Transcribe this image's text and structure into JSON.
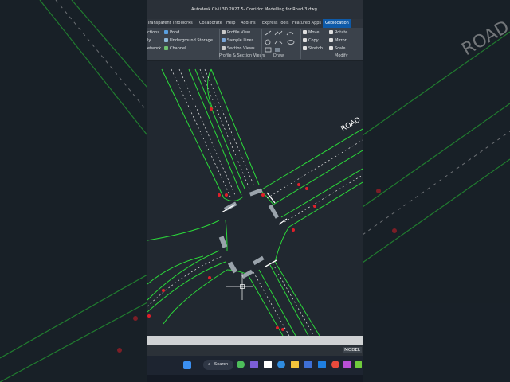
{
  "window": {
    "title": "Autodesk Civil 3D 2027   5- Corridor Modelling for Road-3.dwg"
  },
  "menu": [
    "Transparent",
    "InfoWorks",
    "Collaborate",
    "Help",
    "Add-ins",
    "Express Tools",
    "Featured Apps",
    "Geolocation"
  ],
  "ribbon": {
    "left_items": [
      "ctions",
      "ly",
      "etwork"
    ],
    "group1": [
      "Pond",
      "Underground Storage",
      "Channel"
    ],
    "group2": [
      "Profile View",
      "Sample Lines",
      "Section Views"
    ],
    "panel_profile": "Profile & Section Views",
    "panel_draw": "Draw",
    "modify": [
      "Move",
      "Rotate",
      "Copy",
      "Mirror",
      "Stretch",
      "Scale"
    ],
    "panel_modify": "Modify"
  },
  "drawing": {
    "road_label": "ROAD"
  },
  "background": {
    "right_label": "ROAD"
  },
  "status": {
    "model_label": "MODEL"
  },
  "taskbar": {
    "search_label": "Search"
  },
  "colors": {
    "accent": "#0e5aa8",
    "road_edge": "#2bd93a",
    "marking": "#ffffff",
    "annotation": "#e0202a",
    "viewport": "#212830"
  }
}
